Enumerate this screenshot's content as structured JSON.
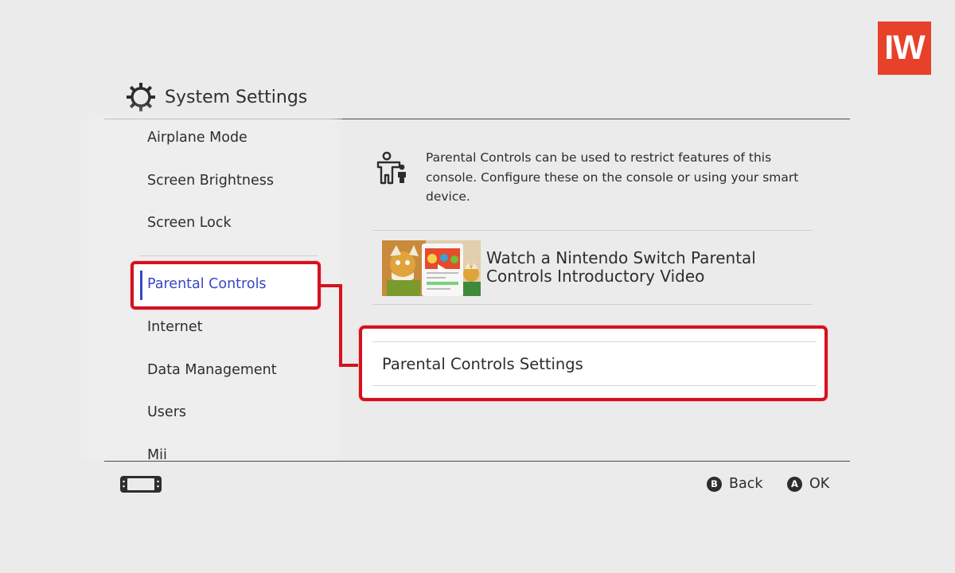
{
  "logo": {
    "text": "IW"
  },
  "header": {
    "title": "System Settings",
    "icon": "gear-icon"
  },
  "sidebar": {
    "items": [
      {
        "label": "Airplane Mode"
      },
      {
        "label": "Screen Brightness"
      },
      {
        "label": "Screen Lock"
      },
      {
        "label": "Parental Controls",
        "selected": true
      },
      {
        "label": "Internet"
      },
      {
        "label": "Data Management"
      },
      {
        "label": "Users"
      },
      {
        "label": "Mii"
      }
    ]
  },
  "main": {
    "info_icon": "parental-controls-icon",
    "description": "Parental Controls can be used to restrict features of this console. Configure these on the console or using your smart device.",
    "video": {
      "title": "Watch a Nintendo Switch Parental Controls Introductory Video",
      "thumbnail_icon": "video-thumbnail"
    },
    "settings_button": {
      "label": "Parental Controls Settings"
    }
  },
  "footer": {
    "console_icon": "switch-console-icon",
    "back": {
      "key": "B",
      "label": "Back"
    },
    "ok": {
      "key": "A",
      "label": "OK"
    }
  },
  "colors": {
    "background": "#ebebeb",
    "accent_blue": "#3646c8",
    "highlight_red": "#d4121e",
    "logo_red": "#e8412a"
  }
}
